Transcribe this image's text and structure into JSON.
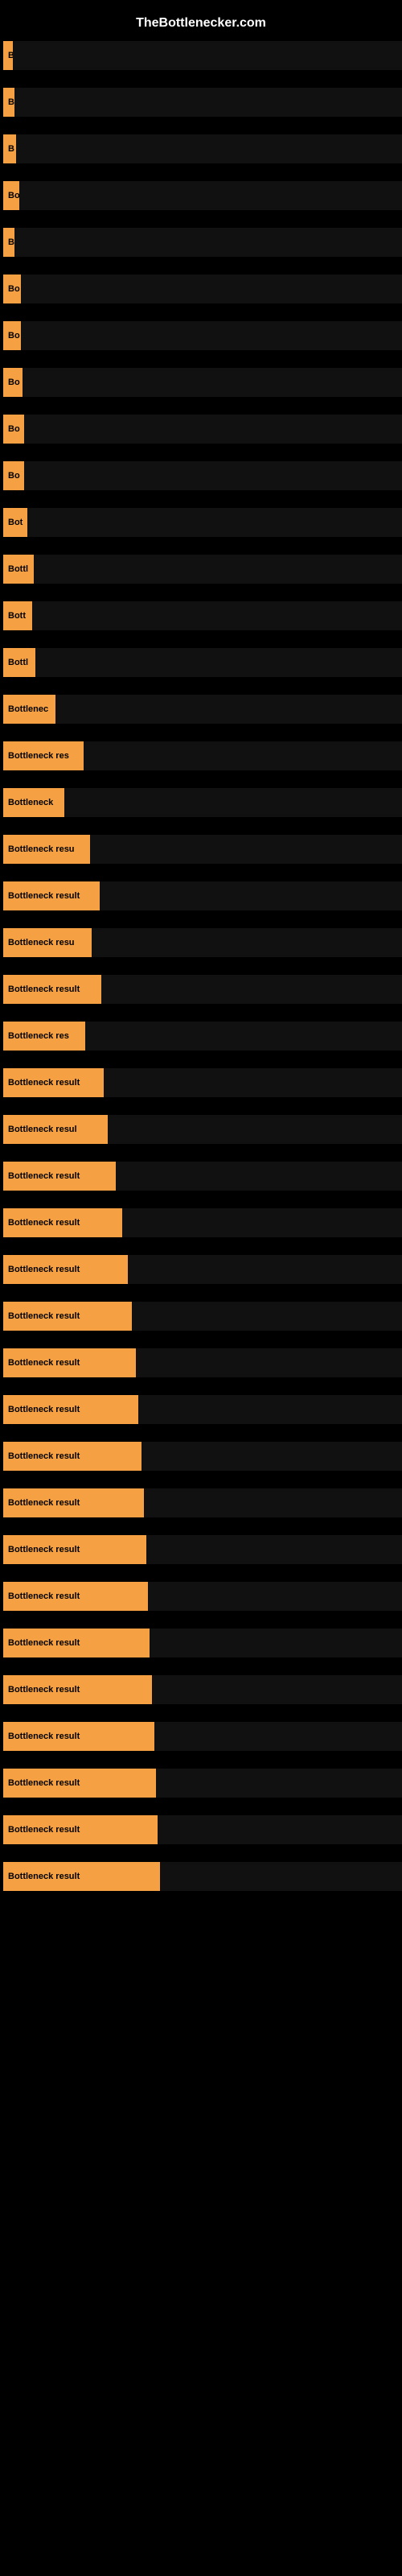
{
  "site": {
    "title": "TheBottlenecker.com"
  },
  "rows": [
    {
      "id": 1,
      "label": "B",
      "width": 12
    },
    {
      "id": 2,
      "label": "B",
      "width": 14
    },
    {
      "id": 3,
      "label": "B",
      "width": 16
    },
    {
      "id": 4,
      "label": "Bo",
      "width": 20
    },
    {
      "id": 5,
      "label": "B",
      "width": 14
    },
    {
      "id": 6,
      "label": "Bo",
      "width": 22
    },
    {
      "id": 7,
      "label": "Bo",
      "width": 22
    },
    {
      "id": 8,
      "label": "Bo",
      "width": 24
    },
    {
      "id": 9,
      "label": "Bo",
      "width": 26
    },
    {
      "id": 10,
      "label": "Bo",
      "width": 26
    },
    {
      "id": 11,
      "label": "Bot",
      "width": 30
    },
    {
      "id": 12,
      "label": "Bottl",
      "width": 38
    },
    {
      "id": 13,
      "label": "Bott",
      "width": 36
    },
    {
      "id": 14,
      "label": "Bottl",
      "width": 40
    },
    {
      "id": 15,
      "label": "Bottlenec",
      "width": 65
    },
    {
      "id": 16,
      "label": "Bottleneck res",
      "width": 100
    },
    {
      "id": 17,
      "label": "Bottleneck",
      "width": 76
    },
    {
      "id": 18,
      "label": "Bottleneck resu",
      "width": 108
    },
    {
      "id": 19,
      "label": "Bottleneck result",
      "width": 120
    },
    {
      "id": 20,
      "label": "Bottleneck resu",
      "width": 110
    },
    {
      "id": 21,
      "label": "Bottleneck result",
      "width": 122
    },
    {
      "id": 22,
      "label": "Bottleneck res",
      "width": 102
    },
    {
      "id": 23,
      "label": "Bottleneck result",
      "width": 125
    },
    {
      "id": 24,
      "label": "Bottleneck resul",
      "width": 130
    },
    {
      "id": 25,
      "label": "Bottleneck result",
      "width": 140
    },
    {
      "id": 26,
      "label": "Bottleneck result",
      "width": 148
    },
    {
      "id": 27,
      "label": "Bottleneck result",
      "width": 155
    },
    {
      "id": 28,
      "label": "Bottleneck result",
      "width": 160
    },
    {
      "id": 29,
      "label": "Bottleneck result",
      "width": 165
    },
    {
      "id": 30,
      "label": "Bottleneck result",
      "width": 168
    },
    {
      "id": 31,
      "label": "Bottleneck result",
      "width": 172
    },
    {
      "id": 32,
      "label": "Bottleneck result",
      "width": 175
    },
    {
      "id": 33,
      "label": "Bottleneck result",
      "width": 178
    },
    {
      "id": 34,
      "label": "Bottleneck result",
      "width": 180
    },
    {
      "id": 35,
      "label": "Bottleneck result",
      "width": 182
    },
    {
      "id": 36,
      "label": "Bottleneck result",
      "width": 185
    },
    {
      "id": 37,
      "label": "Bottleneck result",
      "width": 188
    },
    {
      "id": 38,
      "label": "Bottleneck result",
      "width": 190
    },
    {
      "id": 39,
      "label": "Bottleneck result",
      "width": 192
    },
    {
      "id": 40,
      "label": "Bottleneck result",
      "width": 195
    }
  ]
}
